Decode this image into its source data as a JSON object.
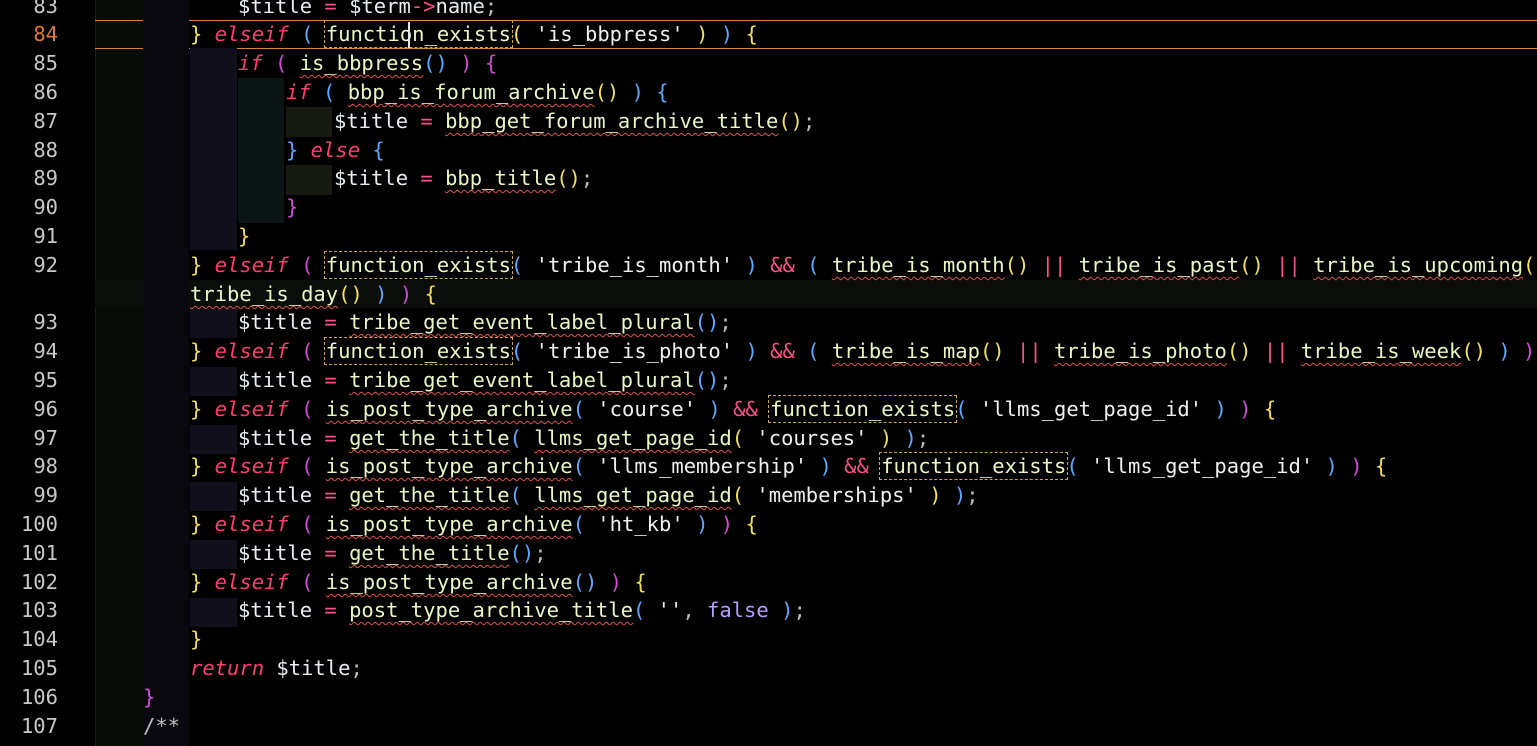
{
  "editor": {
    "active_line": "84",
    "lines": [
      {
        "n": "83",
        "tokens": [
          [
            "v",
            "$title"
          ],
          [
            "o",
            " = "
          ],
          [
            "v",
            "$term"
          ],
          [
            "o",
            "->"
          ],
          [
            "v",
            "name"
          ],
          [
            "c",
            ";"
          ]
        ]
      },
      {
        "n": "84",
        "tokens": [
          [
            "p1",
            "}"
          ],
          [
            "k",
            " elseif"
          ],
          [
            "c",
            " "
          ],
          [
            "p3",
            "("
          ],
          [
            "c",
            " "
          ],
          [
            "fb",
            "function_exists"
          ],
          [
            "p1",
            "("
          ],
          [
            "s",
            " 'is_bbpress' "
          ],
          [
            "p1",
            ")"
          ],
          [
            "c",
            " "
          ],
          [
            "p3",
            ")"
          ],
          [
            "c",
            " "
          ],
          [
            "p1",
            "{"
          ]
        ]
      },
      {
        "n": "85",
        "tokens": [
          [
            "k",
            "if"
          ],
          [
            "c",
            " "
          ],
          [
            "p2",
            "("
          ],
          [
            "c",
            " "
          ],
          [
            "f",
            "is_bbpress"
          ],
          [
            "p3",
            "()"
          ],
          [
            "c",
            " "
          ],
          [
            "p2",
            ")"
          ],
          [
            "c",
            " "
          ],
          [
            "p2",
            "{"
          ]
        ]
      },
      {
        "n": "86",
        "tokens": [
          [
            "k",
            "if"
          ],
          [
            "c",
            " "
          ],
          [
            "p3",
            "("
          ],
          [
            "c",
            " "
          ],
          [
            "f",
            "bbp_is_forum_archive"
          ],
          [
            "p1",
            "()"
          ],
          [
            "c",
            " "
          ],
          [
            "p3",
            ")"
          ],
          [
            "c",
            " "
          ],
          [
            "p3",
            "{"
          ]
        ]
      },
      {
        "n": "87",
        "tokens": [
          [
            "v",
            "$title"
          ],
          [
            "o",
            " = "
          ],
          [
            "f",
            "bbp_get_forum_archive_title"
          ],
          [
            "p1",
            "()"
          ],
          [
            "c",
            ";"
          ]
        ]
      },
      {
        "n": "88",
        "tokens": [
          [
            "p3",
            "}"
          ],
          [
            "k",
            " else"
          ],
          [
            "c",
            " "
          ],
          [
            "p3",
            "{"
          ]
        ]
      },
      {
        "n": "89",
        "tokens": [
          [
            "v",
            "$title"
          ],
          [
            "o",
            " = "
          ],
          [
            "f",
            "bbp_title"
          ],
          [
            "p1",
            "()"
          ],
          [
            "c",
            ";"
          ]
        ]
      },
      {
        "n": "90",
        "tokens": [
          [
            "p2",
            "}"
          ]
        ]
      },
      {
        "n": "91",
        "tokens": [
          [
            "p1",
            "}"
          ]
        ]
      },
      {
        "n": "92",
        "tokens": [
          [
            "p1",
            "}"
          ],
          [
            "k",
            " elseif"
          ],
          [
            "c",
            " "
          ],
          [
            "p2",
            "("
          ],
          [
            "c",
            " "
          ],
          [
            "fb",
            "function_exists"
          ],
          [
            "p3",
            "("
          ],
          [
            "s",
            " 'tribe_is_month' "
          ],
          [
            "p3",
            ")"
          ],
          [
            "o",
            " && "
          ],
          [
            "p3",
            "("
          ],
          [
            "c",
            " "
          ],
          [
            "f",
            "tribe_is_month"
          ],
          [
            "p1",
            "()"
          ],
          [
            "o",
            " || "
          ],
          [
            "f",
            "tribe_is_past"
          ],
          [
            "p1",
            "()"
          ],
          [
            "o",
            " || "
          ],
          [
            "f",
            "tribe_is_upcoming"
          ],
          [
            "p1",
            "()"
          ],
          [
            "o",
            " ||"
          ]
        ]
      },
      {
        "n": "",
        "tokens": [
          [
            "f",
            "tribe_is_day"
          ],
          [
            "p1",
            "()"
          ],
          [
            "c",
            " "
          ],
          [
            "p3",
            ")"
          ],
          [
            "c",
            " "
          ],
          [
            "p2",
            ")"
          ],
          [
            "c",
            " "
          ],
          [
            "p1",
            "{"
          ]
        ]
      },
      {
        "n": "93",
        "tokens": [
          [
            "v",
            "$title"
          ],
          [
            "o",
            " = "
          ],
          [
            "f",
            "tribe_get_event_label_plural"
          ],
          [
            "p3",
            "()"
          ],
          [
            "c",
            ";"
          ]
        ]
      },
      {
        "n": "94",
        "tokens": [
          [
            "p1",
            "}"
          ],
          [
            "k",
            " elseif"
          ],
          [
            "c",
            " "
          ],
          [
            "p2",
            "("
          ],
          [
            "c",
            " "
          ],
          [
            "fb",
            "function_exists"
          ],
          [
            "p3",
            "("
          ],
          [
            "s",
            " 'tribe_is_photo' "
          ],
          [
            "p3",
            ")"
          ],
          [
            "o",
            " && "
          ],
          [
            "p3",
            "("
          ],
          [
            "c",
            " "
          ],
          [
            "f",
            "tribe_is_map"
          ],
          [
            "p1",
            "()"
          ],
          [
            "o",
            " || "
          ],
          [
            "f",
            "tribe_is_photo"
          ],
          [
            "p1",
            "()"
          ],
          [
            "o",
            " || "
          ],
          [
            "f",
            "tribe_is_week"
          ],
          [
            "p1",
            "()"
          ],
          [
            "c",
            " "
          ],
          [
            "p3",
            ")"
          ],
          [
            "c",
            " "
          ],
          [
            "p2",
            ")"
          ],
          [
            "c",
            " "
          ],
          [
            "p1",
            "{"
          ]
        ]
      },
      {
        "n": "95",
        "tokens": [
          [
            "v",
            "$title"
          ],
          [
            "o",
            " = "
          ],
          [
            "f",
            "tribe_get_event_label_plural"
          ],
          [
            "p3",
            "()"
          ],
          [
            "c",
            ";"
          ]
        ]
      },
      {
        "n": "96",
        "tokens": [
          [
            "p1",
            "}"
          ],
          [
            "k",
            " elseif"
          ],
          [
            "c",
            " "
          ],
          [
            "p2",
            "("
          ],
          [
            "c",
            " "
          ],
          [
            "f",
            "is_post_type_archive"
          ],
          [
            "p3",
            "("
          ],
          [
            "s",
            " 'course' "
          ],
          [
            "p3",
            ")"
          ],
          [
            "o",
            " && "
          ],
          [
            "fb",
            "function_exists"
          ],
          [
            "p3",
            "("
          ],
          [
            "s",
            " 'llms_get_page_id' "
          ],
          [
            "p3",
            ")"
          ],
          [
            "c",
            " "
          ],
          [
            "p2",
            ")"
          ],
          [
            "c",
            " "
          ],
          [
            "p1",
            "{"
          ]
        ]
      },
      {
        "n": "97",
        "tokens": [
          [
            "v",
            "$title"
          ],
          [
            "o",
            " = "
          ],
          [
            "f",
            "get_the_title"
          ],
          [
            "p3",
            "("
          ],
          [
            "c",
            " "
          ],
          [
            "f",
            "llms_get_page_id"
          ],
          [
            "p1",
            "("
          ],
          [
            "s",
            " 'courses' "
          ],
          [
            "p1",
            ")"
          ],
          [
            "c",
            " "
          ],
          [
            "p3",
            ")"
          ],
          [
            "c",
            ";"
          ]
        ]
      },
      {
        "n": "98",
        "tokens": [
          [
            "p1",
            "}"
          ],
          [
            "k",
            " elseif"
          ],
          [
            "c",
            " "
          ],
          [
            "p2",
            "("
          ],
          [
            "c",
            " "
          ],
          [
            "f",
            "is_post_type_archive"
          ],
          [
            "p3",
            "("
          ],
          [
            "s",
            " 'llms_membership' "
          ],
          [
            "p3",
            ")"
          ],
          [
            "o",
            " && "
          ],
          [
            "fb",
            "function_exists"
          ],
          [
            "p3",
            "("
          ],
          [
            "s",
            " 'llms_get_page_id' "
          ],
          [
            "p3",
            ")"
          ],
          [
            "c",
            " "
          ],
          [
            "p2",
            ")"
          ],
          [
            "c",
            " "
          ],
          [
            "p1",
            "{"
          ]
        ]
      },
      {
        "n": "99",
        "tokens": [
          [
            "v",
            "$title"
          ],
          [
            "o",
            " = "
          ],
          [
            "f",
            "get_the_title"
          ],
          [
            "p3",
            "("
          ],
          [
            "c",
            " "
          ],
          [
            "f",
            "llms_get_page_id"
          ],
          [
            "p1",
            "("
          ],
          [
            "s",
            " 'memberships' "
          ],
          [
            "p1",
            ")"
          ],
          [
            "c",
            " "
          ],
          [
            "p3",
            ")"
          ],
          [
            "c",
            ";"
          ]
        ]
      },
      {
        "n": "100",
        "tokens": [
          [
            "p1",
            "}"
          ],
          [
            "k",
            " elseif"
          ],
          [
            "c",
            " "
          ],
          [
            "p2",
            "("
          ],
          [
            "c",
            " "
          ],
          [
            "f",
            "is_post_type_archive"
          ],
          [
            "p3",
            "("
          ],
          [
            "s",
            " 'ht_kb' "
          ],
          [
            "p3",
            ")"
          ],
          [
            "c",
            " "
          ],
          [
            "p2",
            ")"
          ],
          [
            "c",
            " "
          ],
          [
            "p1",
            "{"
          ]
        ]
      },
      {
        "n": "101",
        "tokens": [
          [
            "v",
            "$title"
          ],
          [
            "o",
            " = "
          ],
          [
            "f",
            "get_the_title"
          ],
          [
            "p3",
            "()"
          ],
          [
            "c",
            ";"
          ]
        ]
      },
      {
        "n": "102",
        "tokens": [
          [
            "p1",
            "}"
          ],
          [
            "k",
            " elseif"
          ],
          [
            "c",
            " "
          ],
          [
            "p2",
            "("
          ],
          [
            "c",
            " "
          ],
          [
            "f",
            "is_post_type_archive"
          ],
          [
            "p3",
            "()"
          ],
          [
            "c",
            " "
          ],
          [
            "p2",
            ")"
          ],
          [
            "c",
            " "
          ],
          [
            "p1",
            "{"
          ]
        ]
      },
      {
        "n": "103",
        "tokens": [
          [
            "v",
            "$title"
          ],
          [
            "o",
            " = "
          ],
          [
            "f",
            "post_type_archive_title"
          ],
          [
            "p3",
            "("
          ],
          [
            "s",
            " ''"
          ],
          [
            "c",
            ","
          ],
          [
            "bool",
            " false"
          ],
          [
            "c",
            " "
          ],
          [
            "p3",
            ")"
          ],
          [
            "c",
            ";"
          ]
        ]
      },
      {
        "n": "104",
        "tokens": [
          [
            "p1",
            "}"
          ]
        ]
      },
      {
        "n": "105",
        "tokens": [
          [
            "k",
            "return"
          ],
          [
            "v",
            " $title"
          ],
          [
            "c",
            ";"
          ]
        ]
      },
      {
        "n": "106",
        "tokens": [
          [
            "p2",
            "}"
          ]
        ]
      },
      {
        "n": "107",
        "tokens": [
          [
            "c",
            "/**"
          ]
        ]
      }
    ]
  },
  "colors": {
    "background": "#000000",
    "keyword": "#ff3d6e",
    "function": "#eaf7c4",
    "squiggle": "#e0524d",
    "active_line_border": "#d8862f",
    "active_line_number": "#e07a3c"
  }
}
